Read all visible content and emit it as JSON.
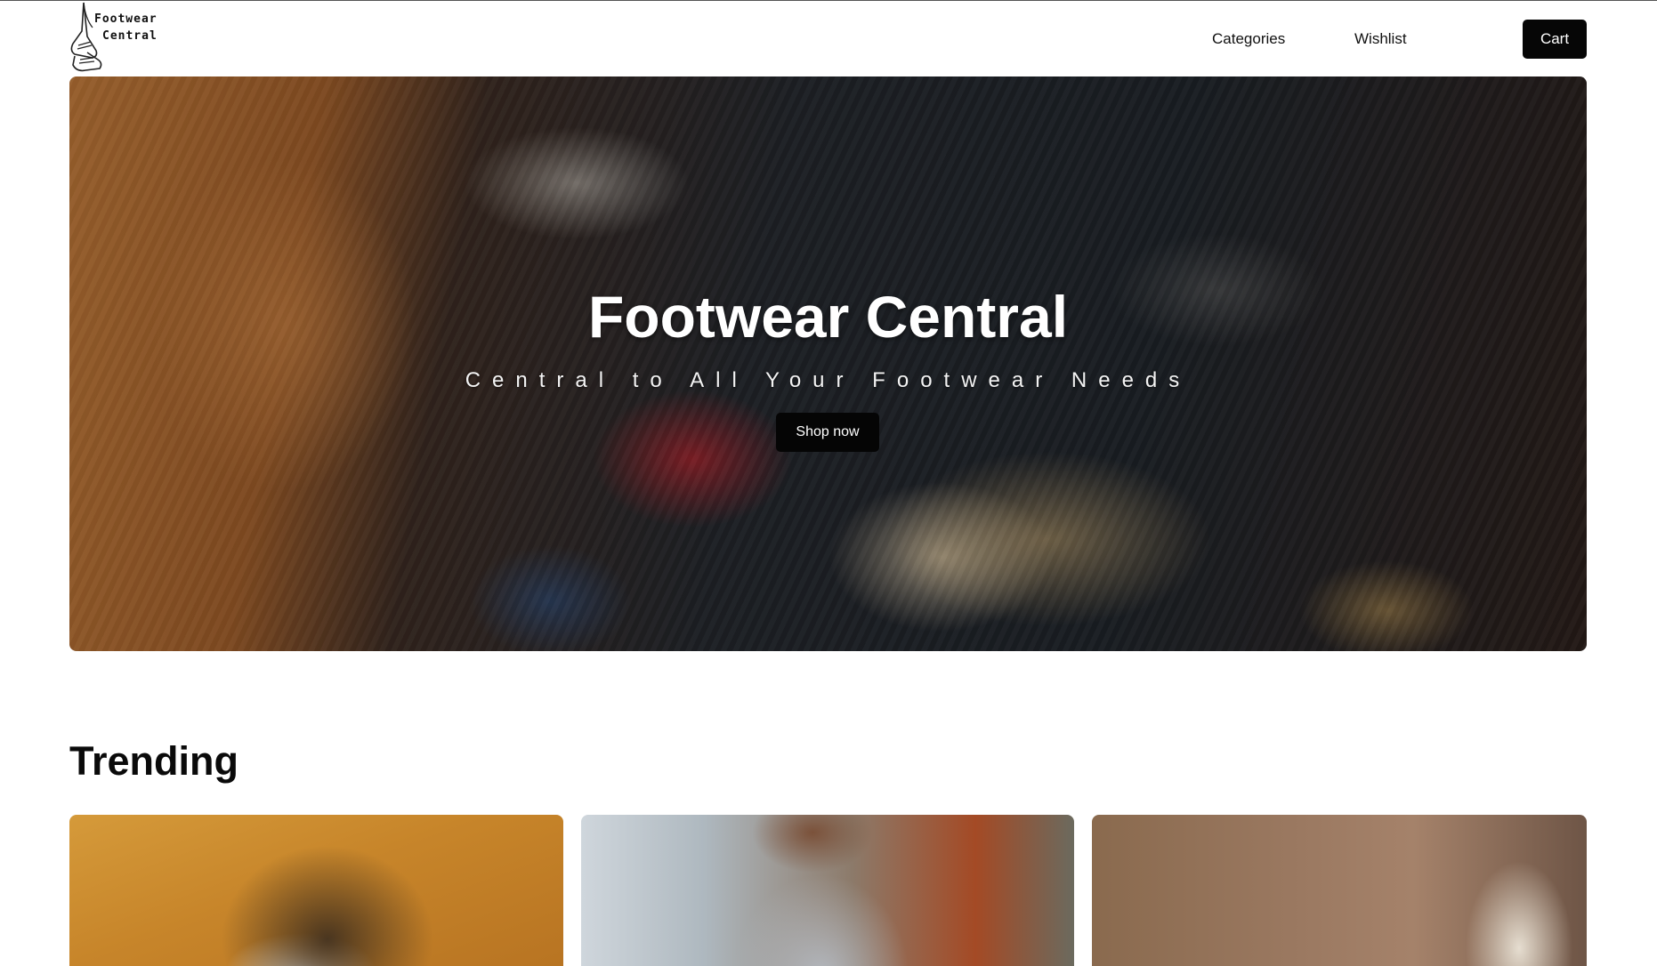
{
  "brand": {
    "logo_line1": "Footwear",
    "logo_line2": "Central"
  },
  "nav": {
    "categories": "Categories",
    "wishlist": "Wishlist",
    "cart": "Cart"
  },
  "hero": {
    "title": "Footwear Central",
    "subtitle": "Central to All Your Footwear Needs",
    "cta": "Shop now"
  },
  "trending": {
    "heading": "Trending",
    "cards": [
      {
        "image": "brown-sneaker-on-orange-fabric"
      },
      {
        "image": "grey-sneaker-on-foot"
      },
      {
        "image": "cream-high-heel"
      }
    ]
  },
  "colors": {
    "button_bg": "#060606",
    "button_text": "#ffffff",
    "hero_title": "#ffffff"
  }
}
